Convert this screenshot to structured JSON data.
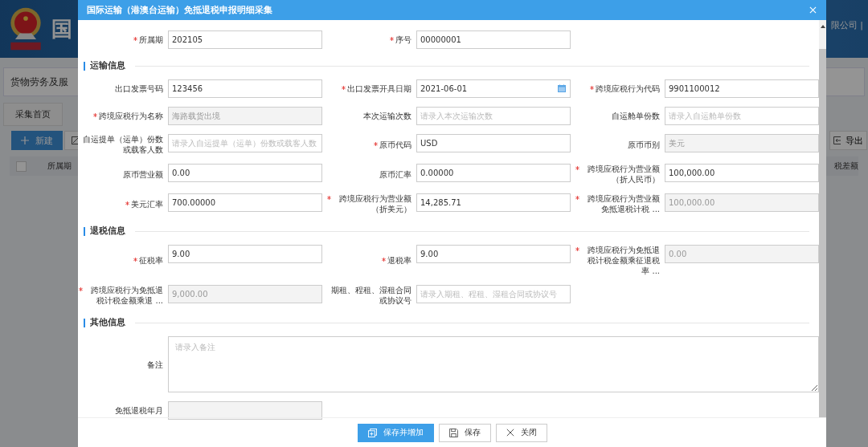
{
  "background": {
    "header_title": "国",
    "header_right": "限公司 |",
    "breadcrumb": "货物劳务及服",
    "tabs": [
      {
        "label": "采集首页",
        "selected": false
      }
    ],
    "header_checkbox": {
      "checked": false
    },
    "new_button": "新建",
    "export_button": "导出",
    "table_columns": [
      "所属期",
      "税差额"
    ]
  },
  "dialog": {
    "title": "国际运输（港澳台运输）免抵退税申报明细采集",
    "top_fields": [
      {
        "label": "所属期",
        "required": true,
        "kind": "text",
        "value": "202105",
        "disabled": false
      },
      {
        "label": "序号",
        "required": true,
        "kind": "text",
        "value": "00000001",
        "disabled": false
      }
    ],
    "sections": [
      {
        "title": "运输信息",
        "fields": [
          {
            "label": "出口发票号码",
            "required": false,
            "kind": "text",
            "value": "123456",
            "disabled": false
          },
          {
            "label": "出口发票开具日期",
            "required": true,
            "kind": "date",
            "value": "2021-06-01",
            "disabled": false
          },
          {
            "label": "跨境应税行为代码",
            "required": true,
            "kind": "text",
            "value": "9901100012",
            "disabled": false
          },
          {
            "label": "跨境应税行为名称",
            "required": true,
            "kind": "text",
            "value": "海路载货出境",
            "disabled": true
          },
          {
            "label": "本次运输次数",
            "required": false,
            "kind": "text",
            "placeholder": "请录入本次运输次数",
            "disabled": false
          },
          {
            "label": "自运舱单份数",
            "required": false,
            "kind": "text",
            "placeholder": "请录入自运舱单份数",
            "disabled": false
          },
          {
            "label": "自运提单（运单）份数或载客人数",
            "required": false,
            "kind": "text",
            "placeholder": "请录入自运提单（运单）份数或载客人数",
            "disabled": false
          },
          {
            "label": "原币代码",
            "required": true,
            "kind": "text",
            "value": "USD",
            "disabled": false
          },
          {
            "label": "原币币别",
            "required": false,
            "kind": "text",
            "value": "美元",
            "disabled": true
          },
          {
            "label": "原币营业额",
            "required": false,
            "kind": "text",
            "value": "0.00",
            "disabled": false
          },
          {
            "label": "原币汇率",
            "required": false,
            "kind": "text",
            "value": "0.00000",
            "disabled": false
          },
          {
            "label": "跨境应税行为营业额（折人民币）",
            "required": true,
            "kind": "text",
            "value": "100,000.00",
            "disabled": false
          },
          {
            "label": "美元汇率",
            "required": true,
            "kind": "text",
            "value": "700.00000",
            "disabled": false
          },
          {
            "label": "跨境应税行为营业额（折美元）",
            "required": true,
            "kind": "text",
            "value": "14,285.71",
            "disabled": false
          },
          {
            "label": "跨境应税行为营业额免抵退税计税 ...",
            "required": true,
            "kind": "text",
            "value": "100,000.00",
            "disabled": true
          }
        ]
      },
      {
        "title": "退税信息",
        "fields": [
          {
            "label": "征税率",
            "required": true,
            "kind": "text",
            "value": "9.00",
            "disabled": false
          },
          {
            "label": "退税率",
            "required": true,
            "kind": "text",
            "value": "9.00",
            "disabled": false
          },
          {
            "label": "跨境应税行为免抵退税计税金额乘征退税率 ...",
            "required": true,
            "kind": "text",
            "value": "0.00",
            "disabled": true
          },
          {
            "label": "跨境应税行为免抵退税计税金额乘退 ...",
            "required": true,
            "kind": "text",
            "value": "9,000.00",
            "disabled": true
          },
          {
            "label": "期租、程租、湿租合同或协议号",
            "required": false,
            "kind": "text",
            "placeholder": "请录入期租、程租、湿租合同或协议号",
            "disabled": false
          }
        ]
      },
      {
        "title": "其他信息",
        "fields": [
          {
            "label": "备注",
            "required": false,
            "kind": "textarea",
            "placeholder": "请录入备注",
            "disabled": false
          },
          {
            "label": "免抵退税年月",
            "required": false,
            "kind": "text",
            "disabled": true
          }
        ]
      }
    ],
    "buttons": [
      {
        "label": "保存并增加",
        "kind": "save_and_add"
      },
      {
        "label": "保存",
        "kind": "save"
      },
      {
        "label": "关闭",
        "kind": "close"
      }
    ]
  }
}
